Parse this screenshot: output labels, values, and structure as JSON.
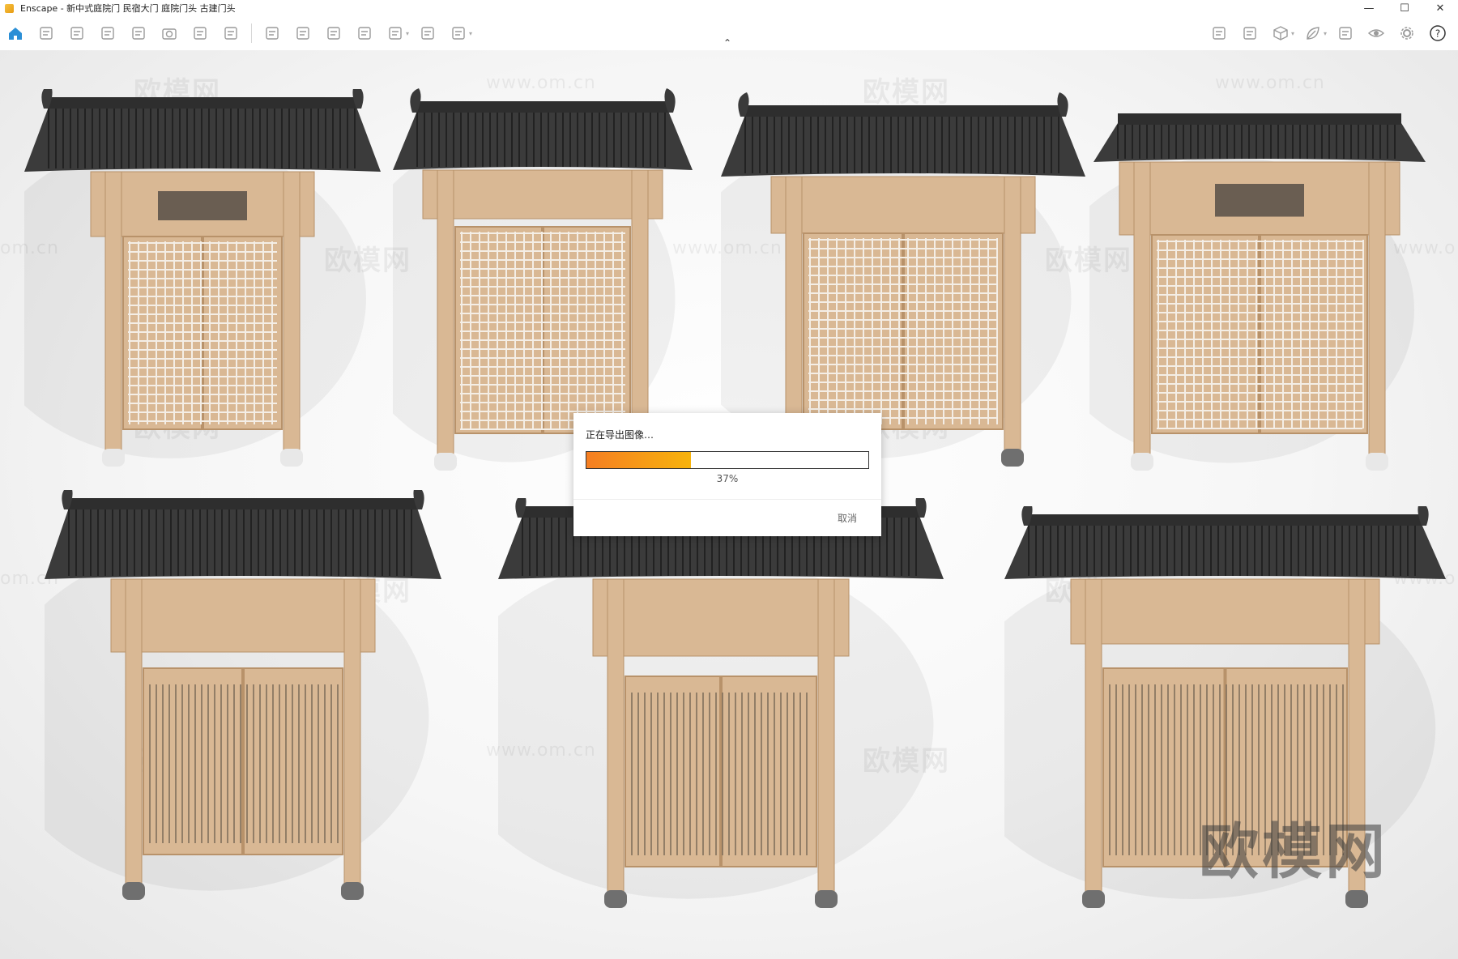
{
  "window": {
    "title": "Enscape - 新中式庭院门 民宿大门 庭院门头 古建门头",
    "controls": {
      "minimize": "—",
      "maximize": "☐",
      "close": "✕"
    }
  },
  "toolbar": {
    "left_icons": [
      "home-icon",
      "project-icon",
      "clipboard-icon",
      "view-management-icon",
      "visual-settings-icon",
      "camera-icon",
      "render-image-icon",
      "screenshot-icon",
      "panorama-icon",
      "batch-icon",
      "settings-icon",
      "asset-library-icon",
      "export-icon",
      "export-video-icon",
      "upload-icon"
    ],
    "right_icons": [
      "material-editor-icon",
      "image-icon",
      "cube-icon",
      "leaf-icon",
      "vr-icon",
      "eye-icon",
      "gear-icon",
      "help-icon"
    ],
    "help_label": "?",
    "collapse_chevron": "⌃"
  },
  "viewport": {
    "watermarks": [
      "欧模网",
      "www.om.cn",
      "欧模网",
      "www.om.cn",
      "om.cn",
      "欧模网",
      "www.om.cn",
      "欧模网",
      "www.o",
      "欧模网",
      "www.om.cn",
      "欧模网",
      "www.om.cn",
      "欧模网",
      "om.cn",
      "欧模网",
      "www.o",
      "欧模网",
      "www.om.cn",
      "欧模网"
    ],
    "watermark_big": "欧模网",
    "gates_count_top": 4,
    "gates_count_bottom": 3
  },
  "dialog": {
    "title": "正在导出图像…",
    "progress": 0.37,
    "percent_label": "37%",
    "cancel_label": "取消"
  },
  "colors": {
    "roof": "#3b3b3b",
    "wood": "#d9b894",
    "wood_dark": "#b8926a",
    "progress_start": "#f57e22",
    "progress_end": "#f7b30c"
  }
}
